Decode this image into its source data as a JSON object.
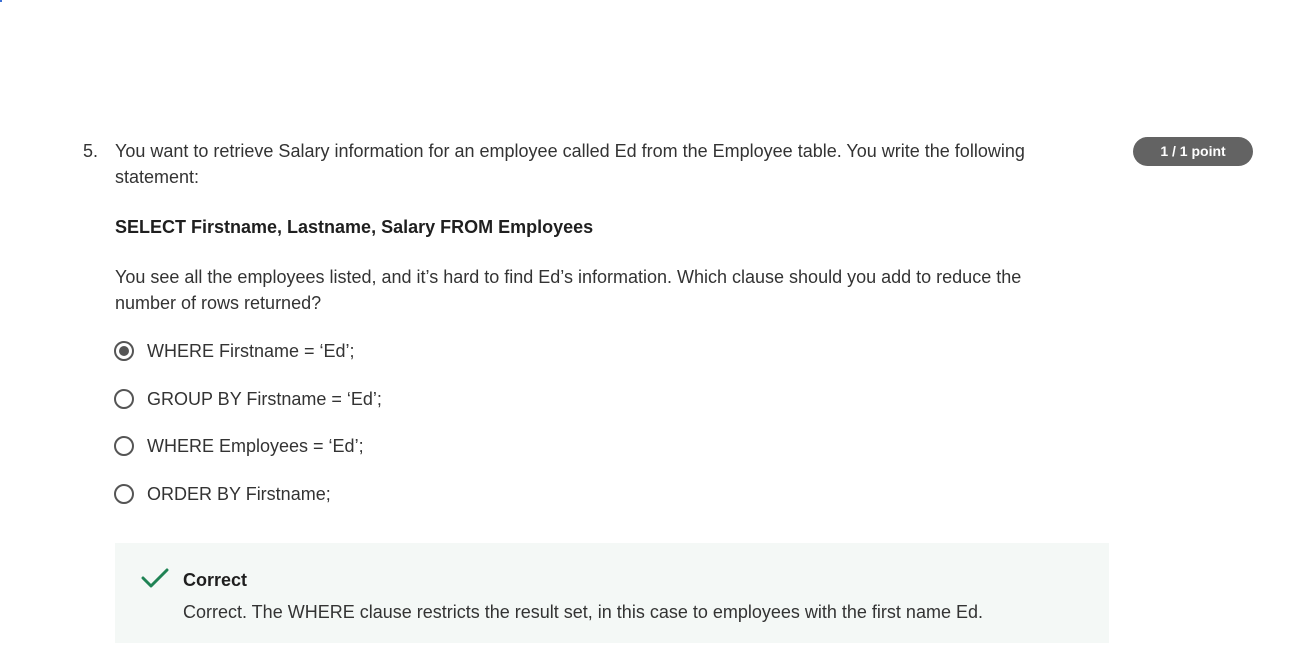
{
  "question": {
    "number": "5.",
    "prompt": "You want to retrieve Salary information for an employee called Ed from the Employee table. You write the following statement:",
    "code": "SELECT Firstname, Lastname, Salary FROM Employees",
    "prompt2": "You see all the employees listed, and it’s hard to find Ed’s information. Which clause should you add to reduce the number of rows returned?",
    "points": "1 / 1 point",
    "options": [
      {
        "label": "WHERE Firstname = ‘Ed’;",
        "selected": true
      },
      {
        "label": "GROUP BY Firstname = ‘Ed’;",
        "selected": false
      },
      {
        "label": "WHERE Employees = ‘Ed’;",
        "selected": false
      },
      {
        "label": "ORDER BY Firstname;",
        "selected": false
      }
    ]
  },
  "feedback": {
    "title": "Correct",
    "text": "Correct. The WHERE clause restricts the result set, in this case to employees with the first name Ed.",
    "icon": "check-icon",
    "accent_color": "#1f8354"
  },
  "colors": {
    "badge_bg": "#636363",
    "feedback_bg": "#f4f8f6",
    "radio": "#555555"
  }
}
